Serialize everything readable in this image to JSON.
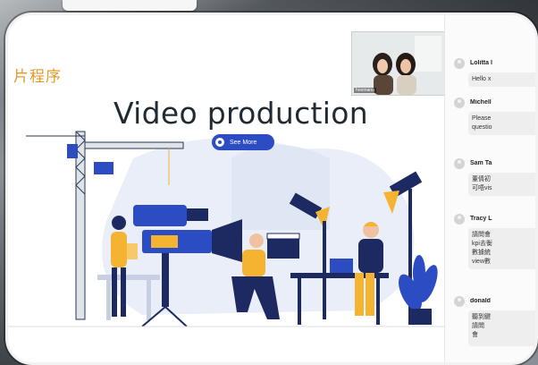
{
  "slide": {
    "title_cn": "片程序",
    "headline": "Video production",
    "see_more": "See More"
  },
  "webcam": {
    "label": "hoomanu"
  },
  "chat": {
    "messages": [
      {
        "name": "Lolitta l",
        "text": "Hello x"
      },
      {
        "name": "Michell",
        "text": "Please\nquestio"
      },
      {
        "name": "Sam Ta",
        "text": "董倩初\n可唔vis"
      },
      {
        "name": "Tracy L",
        "text": "請問會\nkpi去衡\n數據統\nview數"
      },
      {
        "name": "donald",
        "text": "聽到鍵\n請問\n會"
      }
    ]
  },
  "colors": {
    "accent": "#2c4cc4",
    "title_cn": "#e49a2a",
    "shirt_yellow": "#f4b431"
  }
}
